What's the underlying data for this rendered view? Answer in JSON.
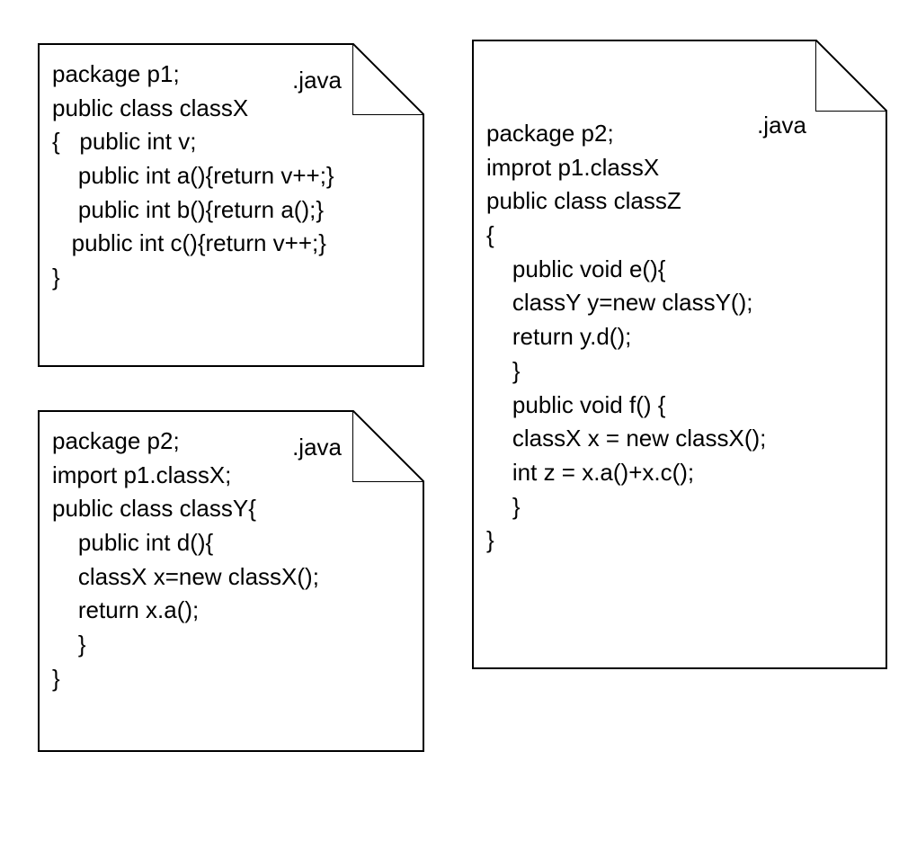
{
  "files": {
    "classX": {
      "ext": ".java",
      "code": "package p1;\npublic class classX\n{   public int v;\n    public int a(){return v++;}\n    public int b(){return a();}\n   public int c(){return v++;}\n}"
    },
    "classY": {
      "ext": ".java",
      "code": "package p2;\nimport p1.classX;\npublic class classY{\n    public int d(){\n    classX x=new classX();\n    return x.a();\n    }\n}"
    },
    "classZ": {
      "ext": ".java",
      "code": "package p2;\nimprot p1.classX\npublic class classZ\n{\n    public void e(){\n    classY y=new classY();\n    return y.d();\n    }\n    public void f() {\n    classX x = new classX();\n    int z = x.a()+x.c();\n    }\n}"
    }
  }
}
